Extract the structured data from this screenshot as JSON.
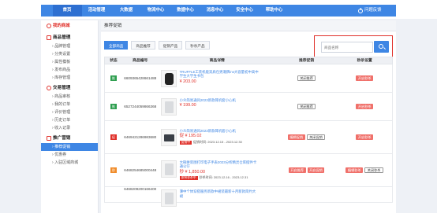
{
  "nav": {
    "items": [
      "首页",
      "活动管理",
      "大数据",
      "物流中心",
      "数据中心",
      "消息中心",
      "安全中心",
      "帮助中心"
    ],
    "logout": "问题反馈"
  },
  "sidebar": {
    "home": "我的商城",
    "groups": [
      {
        "title": "商品管理",
        "links": [
          "品牌管理",
          "分类设置",
          "属性模板",
          "发布商品",
          "库存管理"
        ]
      },
      {
        "title": "交易管理",
        "links": [
          "商品审核",
          "我的订单",
          "评价管理",
          "历史订单",
          "收入记录"
        ]
      },
      {
        "title": "推广营销",
        "links": [
          "推荐促销",
          "优惠券",
          "入驻区域商城"
        ]
      }
    ],
    "active_link": "推荐促销"
  },
  "main": {
    "title": "推荐促销",
    "tabs": [
      "全部商品",
      "商品推荐",
      "促销产品",
      "秒杀产品"
    ],
    "search_placeholder": "商品名称",
    "columns": [
      "状态",
      "商品编号",
      "商品详情",
      "推荐促销",
      "秒杀设置"
    ]
  },
  "rows": [
    {
      "status_label": "推",
      "status_color": "#2e9e4f",
      "code": "6609365428661488",
      "name": "TRUFFLE工装机能双肩包男潮牌ins大容量初中高中学生大学生书包",
      "price": "¥ 203.00",
      "thumb": "backpack",
      "buttons": [
        {
          "label": "关闭推荐",
          "style": "outline"
        }
      ],
      "seckill": [
        {
          "label": "开启秒杀",
          "style": "red"
        }
      ]
    },
    {
      "status_label": "推",
      "status_color": "#2e9e4f",
      "code": "6527244059866368",
      "name": "小众简易通风2023新款耳机套小心机",
      "price": "¥ 199.00",
      "thumb": "light",
      "buttons": [
        {
          "label": "关闭推荐",
          "style": "outline"
        }
      ],
      "seckill": [
        {
          "label": "开启秒杀",
          "style": "red"
        }
      ]
    },
    {
      "status_label": "促",
      "status_color": "#e0302a",
      "code": "6469421286983680",
      "name": "小众简易通风2023新款耳机套小心机",
      "price": "促 ¥ 195.02",
      "thumb": "box",
      "promo_tag": "促销中",
      "promo_time": "促销时间: 2023.12.15 - 2023.12.30",
      "buttons": [
        {
          "label": "编辑促销",
          "style": "red"
        },
        {
          "label": "关闭促销",
          "style": "outline"
        }
      ],
      "seckill": [
        {
          "label": "开启秒杀",
          "style": "red"
        }
      ]
    },
    {
      "status_label": "秒",
      "status_color": "#f08c2b",
      "code": "6468254685000448",
      "name": "大碗拼装图打印电子手表2023分析精灵仓库摆件卡通公仔",
      "price": "秒 ¥ 1,850.00",
      "thumb": "light",
      "promo_tag": "即将秒杀中",
      "promo_time": "秒杀时间: 2023.12.16 - 2023.12.31",
      "buttons": [
        {
          "label": "开启推荐",
          "style": "red"
        },
        {
          "label": "开启促销",
          "style": "red"
        }
      ],
      "seckill": [
        {
          "label": "编辑秒杀",
          "style": "red"
        },
        {
          "label": "关闭秒杀",
          "style": "outline"
        }
      ]
    },
    {
      "status_label": "",
      "status_color": "#ffffff",
      "code": "6468209200166400",
      "name": "薄中个体穿搭服务新款中裙装最新十月新款简约大裙",
      "price": "",
      "thumb": "light",
      "buttons": [],
      "seckill": []
    }
  ]
}
